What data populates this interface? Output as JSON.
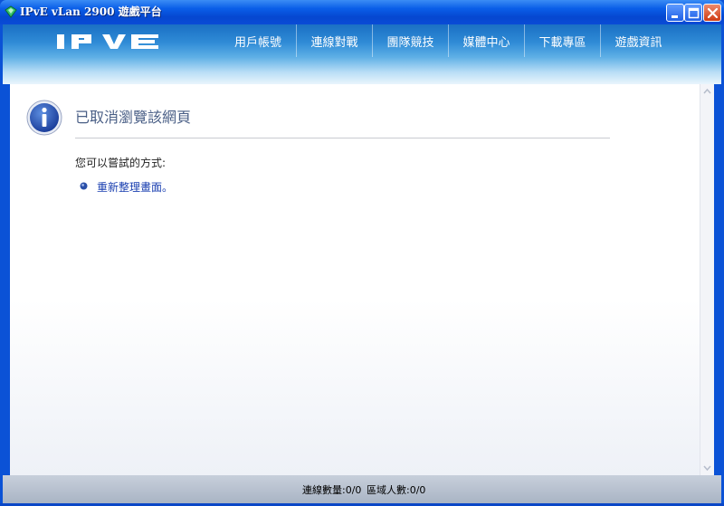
{
  "window": {
    "title": "IPvE vLan 2900 遊戲平台"
  },
  "header": {
    "nav": [
      {
        "label": "用戶帳號"
      },
      {
        "label": "連線對戰"
      },
      {
        "label": "團隊競技"
      },
      {
        "label": "媒體中心"
      },
      {
        "label": "下載專區"
      },
      {
        "label": "遊戲資訊"
      }
    ]
  },
  "content": {
    "title": "已取消瀏覽該網頁",
    "try_text": "您可以嘗試的方式:",
    "refresh_link": "重新整理畫面。"
  },
  "status": {
    "connections": "連線數量:0/0",
    "area_users": "區域人數:0/0"
  },
  "colors": {
    "title_bar": "#0a5ee8",
    "header_top": "#1a6fc4",
    "link": "#1a3fb0",
    "title_text": "#4a5f86"
  },
  "icons": {
    "app": "app-icon",
    "info": "info-icon",
    "bullet": "bullet-icon",
    "minimize": "minimize-icon",
    "maximize": "maximize-icon",
    "close": "close-icon"
  }
}
